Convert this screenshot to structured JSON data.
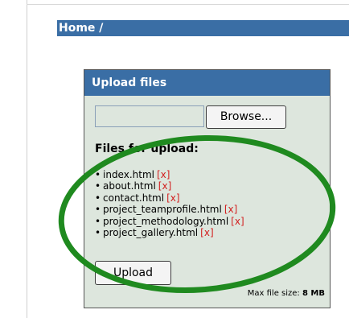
{
  "breadcrumb": {
    "home": "Home",
    "separator": "/"
  },
  "upload_panel": {
    "title": "Upload files",
    "browse_label": "Browse...",
    "files_heading": "Files for upload:",
    "remove_label": "[x]",
    "files": [
      "index.html",
      "about.html",
      "contact.html",
      "project_teamprofile.html",
      "project_methodology.html",
      "project_gallery.html"
    ],
    "upload_label": "Upload",
    "max_size_label": "Max file size:",
    "max_size_value": "8 MB"
  },
  "annotation": {
    "shape": "ellipse",
    "color": "#1f8a1f"
  }
}
